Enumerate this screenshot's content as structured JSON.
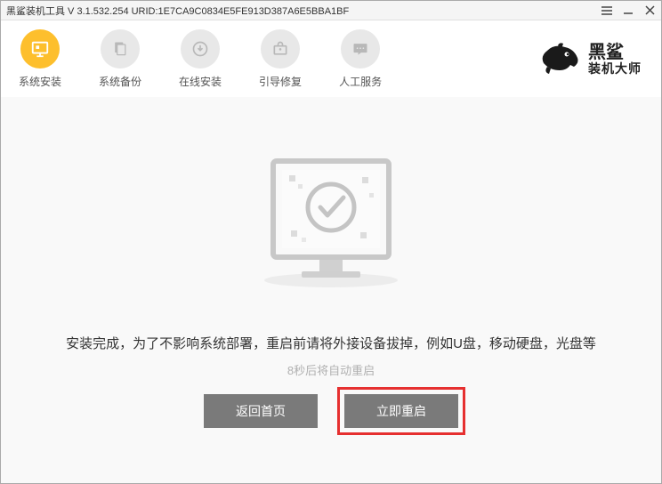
{
  "titlebar": {
    "text": "黑鲨装机工具 V 3.1.532.254 URID:1E7CA9C0834E5FE913D387A6E5BBA1BF"
  },
  "nav": {
    "items": [
      {
        "label": "系统安装",
        "icon": "monitor-icon",
        "active": true
      },
      {
        "label": "系统备份",
        "icon": "backup-icon",
        "active": false
      },
      {
        "label": "在线安装",
        "icon": "download-icon",
        "active": false
      },
      {
        "label": "引导修复",
        "icon": "toolbox-icon",
        "active": false
      },
      {
        "label": "人工服务",
        "icon": "chat-icon",
        "active": false
      }
    ]
  },
  "logo": {
    "line1": "黑鲨",
    "line2": "装机大师"
  },
  "content": {
    "message": "安装完成，为了不影响系统部署，重启前请将外接设备拔掉，例如U盘，移动硬盘，光盘等",
    "countdown": "8秒后将自动重启"
  },
  "buttons": {
    "back": "返回首页",
    "restart": "立即重启"
  }
}
